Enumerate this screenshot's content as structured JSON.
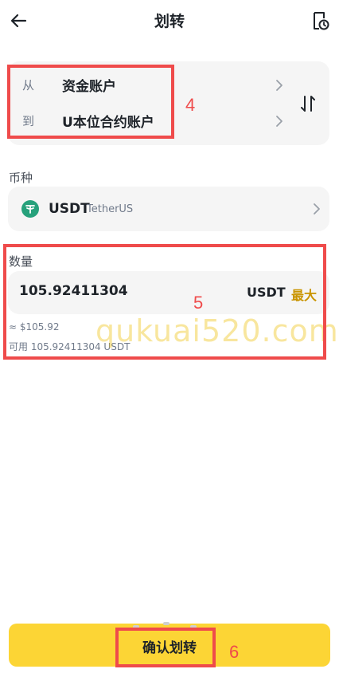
{
  "header": {
    "title": "划转"
  },
  "transfer": {
    "from_label": "从",
    "from_account": "资金账户",
    "to_label": "到",
    "to_account": "U本位合约账户"
  },
  "coin": {
    "section_title": "币种",
    "symbol": "USDT",
    "name": "TetherUS",
    "icon_color": "#26a17b"
  },
  "amount": {
    "section_title": "数量",
    "value": "105.92411304",
    "unit": "USDT",
    "max_label": "最大",
    "usd_equivalent": "≈ $105.92",
    "available": "可用 105.92411304 USDT"
  },
  "confirm": {
    "label": "确认划转"
  },
  "annotations": {
    "label_4": "4",
    "label_5": "5",
    "label_6": "6"
  },
  "watermark": {
    "text": "qukuai520.com"
  },
  "colors": {
    "accent": "#fcd535",
    "max_text": "#c99400",
    "annotation": "#ef4b4b",
    "card_bg": "#f5f5f5"
  },
  "icons": {
    "back": "arrow-left-icon",
    "history": "history-icon",
    "swap": "swap-icon",
    "chevron": "chevron-right-icon",
    "coin": "usdt-coin-icon"
  }
}
